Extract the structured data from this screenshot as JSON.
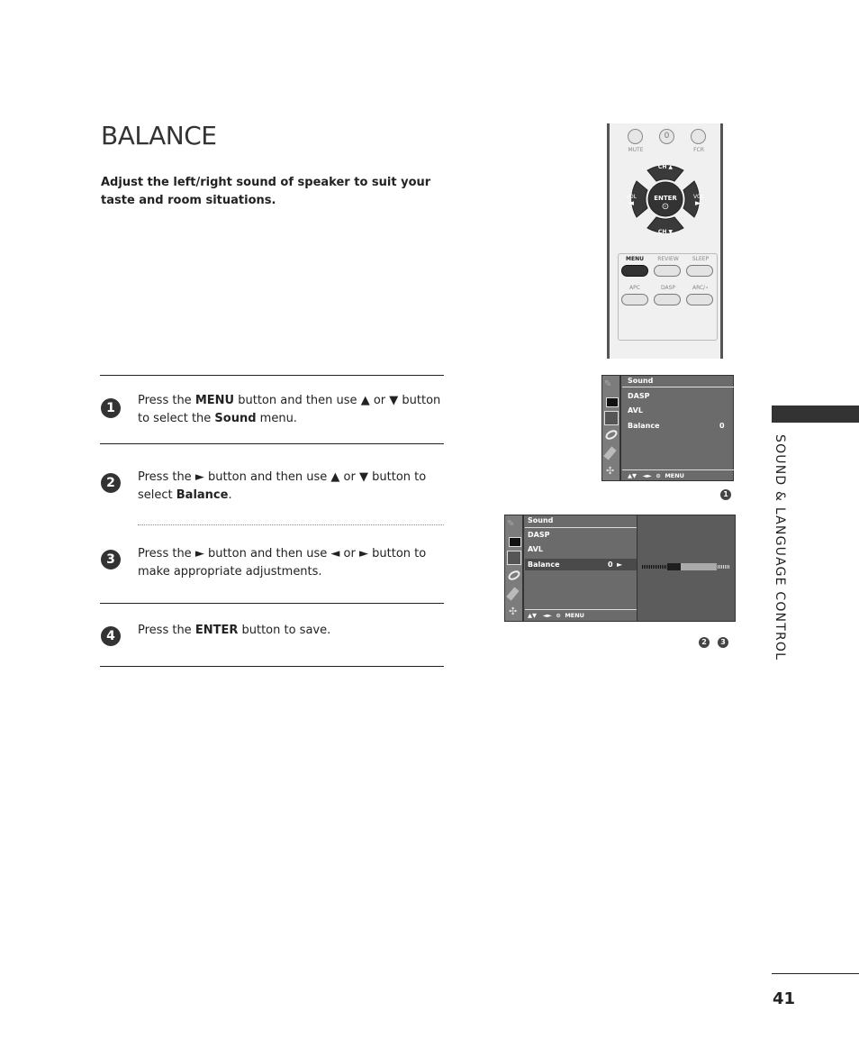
{
  "page": {
    "title": "BALANCE",
    "intro": "Adjust the left/right sound of speaker to suit your taste and room situations.",
    "section_tab": "SOUND & LANGUAGE CONTROL",
    "page_number": "41"
  },
  "steps": [
    {
      "number": "1",
      "parts": [
        {
          "t": "Press the "
        },
        {
          "b": "MENU"
        },
        {
          "t": " button and then use "
        },
        {
          "t": "▲"
        },
        {
          "t": " or "
        },
        {
          "t": "▼"
        },
        {
          "t": " button to select the "
        },
        {
          "b": "Sound"
        },
        {
          "t": " menu."
        }
      ]
    },
    {
      "number": "2",
      "parts": [
        {
          "t": "Press the "
        },
        {
          "t": "►"
        },
        {
          "t": " button and then use "
        },
        {
          "t": "▲"
        },
        {
          "t": " or "
        },
        {
          "t": "▼"
        },
        {
          "t": " button to select "
        },
        {
          "b": "Balance"
        },
        {
          "t": "."
        }
      ]
    },
    {
      "number": "3",
      "parts": [
        {
          "t": "Press the "
        },
        {
          "t": "►"
        },
        {
          "t": " button and then use "
        },
        {
          "t": "◄"
        },
        {
          "t": " or "
        },
        {
          "t": "►"
        },
        {
          "t": " button to make appropriate adjustments."
        }
      ]
    },
    {
      "number": "4",
      "parts": [
        {
          "t": "Press the "
        },
        {
          "b": "ENTER"
        },
        {
          "t": " button to save."
        }
      ]
    }
  ],
  "remote": {
    "top_buttons": {
      "mute": "MUTE",
      "zero": "0",
      "fcr": "FCR"
    },
    "dpad": {
      "ch_up": "CH ▲",
      "ch_down": "CH ▼",
      "vol_left": "VOL",
      "vol_right": "VOL",
      "enter": "ENTER",
      "left_arrow": "◄",
      "right_arrow": "►",
      "enter_glyph": "⊙"
    },
    "row1": [
      "MENU",
      "REVIEW",
      "SLEEP"
    ],
    "row2": [
      "APC",
      "DASP",
      "ARC/⋆"
    ]
  },
  "osd1": {
    "header": "Sound",
    "items": [
      {
        "label": "DASP",
        "value": ""
      },
      {
        "label": "AVL",
        "value": ""
      },
      {
        "label": "Balance",
        "value": "0"
      }
    ],
    "footer": {
      "updown": "▲▼",
      "leftright": "◄►",
      "ok": "⊙",
      "menu": "MENU"
    },
    "badge": "1"
  },
  "osd2": {
    "header": "Sound",
    "items": [
      {
        "label": "DASP",
        "value": ""
      },
      {
        "label": "AVL",
        "value": ""
      },
      {
        "label": "Balance",
        "value": "0",
        "arrow": "►"
      }
    ],
    "footer": {
      "updown": "▲▼",
      "leftright": "◄►",
      "ok": "⊙",
      "menu": "MENU"
    },
    "balance_value": 0,
    "badges": [
      "2",
      "3"
    ]
  },
  "colors": {
    "osd_bg": "#6b6b6b",
    "osd_side": "#7c7c7c",
    "osd_highlight": "#4a4a4a",
    "bar_dark": "#1e1e1e",
    "bar_light": "#aaaaaa"
  }
}
